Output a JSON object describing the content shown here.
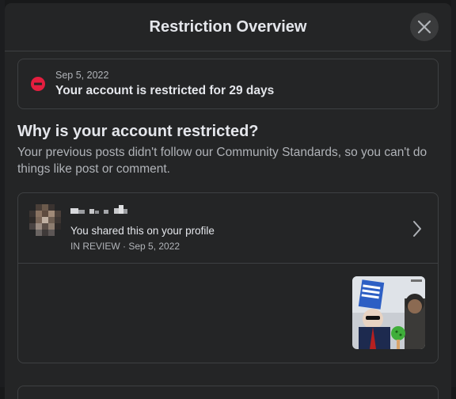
{
  "dialog": {
    "title": "Restriction Overview",
    "close_icon": "close-icon"
  },
  "status": {
    "icon": "restricted-icon",
    "date": "Sep 5, 2022",
    "text": "Your account is restricted for 29 days"
  },
  "reason": {
    "title": "Why is your account restricted?",
    "description": "Your previous posts didn't follow our Community Standards, so you can't do things like post or comment."
  },
  "post": {
    "action": "You shared this on your profile",
    "meta": "IN REVIEW · Sep 5, 2022",
    "chevron_icon": "chevron-right-icon"
  },
  "colors": {
    "dialog_bg": "#242526",
    "text_primary": "#e4e6eb",
    "text_secondary": "#b0b3b8",
    "border": "#3e4042",
    "restricted_red": "#e41e3f"
  }
}
